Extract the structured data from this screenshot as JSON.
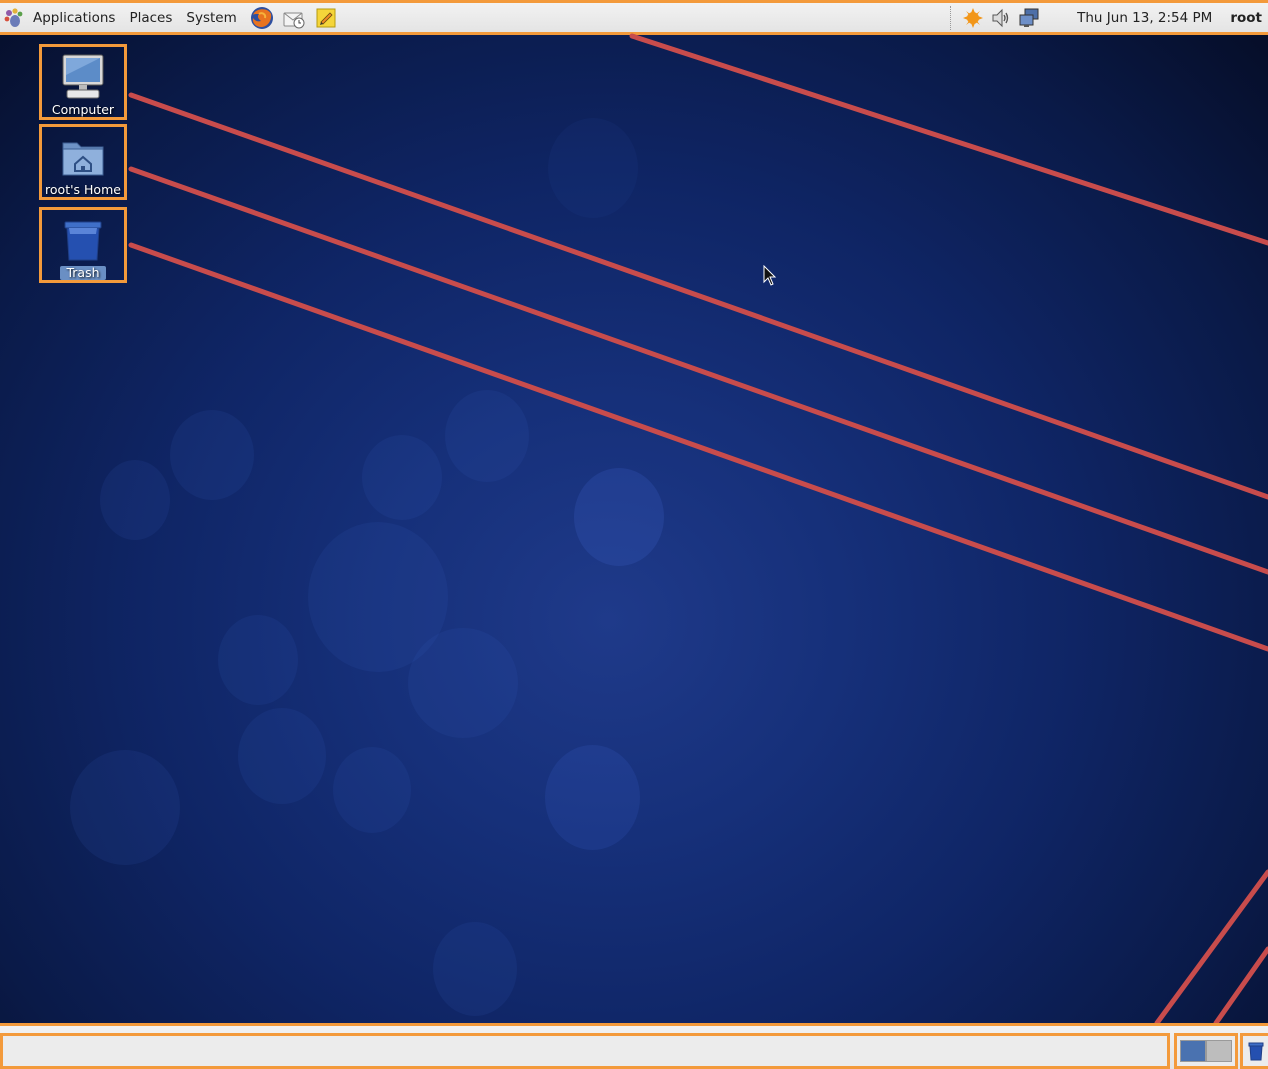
{
  "top_panel": {
    "menus": {
      "applications": "Applications",
      "places": "Places",
      "system": "System"
    },
    "launchers": [
      "firefox-icon",
      "mail-icon",
      "notes-icon"
    ],
    "tray_icons": [
      "update-icon",
      "volume-icon",
      "network-icon"
    ],
    "clock": "Thu Jun 13,  2:54 PM",
    "user": "root"
  },
  "desktop": {
    "icons": [
      {
        "label": "Computer",
        "icon": "computer-icon"
      },
      {
        "label": "root's Home",
        "icon": "home-folder-icon"
      },
      {
        "label": "Trash",
        "icon": "trash-icon"
      }
    ]
  },
  "bottom_panel": {
    "workspaces": 2,
    "active_workspace": 1
  },
  "colors": {
    "panel_bg": "#e8e8e8",
    "highlight_border": "#f39a3b",
    "annotation_line": "#c84c4c",
    "desktop_bg": "#16307a"
  }
}
